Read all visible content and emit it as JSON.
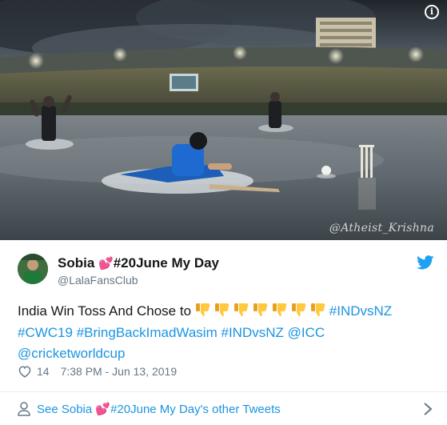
{
  "media": {
    "watermark": "@Atheist_Krishna",
    "info_icon": "i"
  },
  "author": {
    "name_prefix": "Sobia",
    "name_heart": "💕",
    "name_suffix": "#20June My Day",
    "handle": "@LalaFansClub"
  },
  "tweet": {
    "text_intro": "India Win Toss And Chose to ",
    "thumbs_down_count": 7,
    "hashtag_1": "#INDvsNZ",
    "hashtag_2": "#CWC19",
    "hashtag_3": "#BringBackImadWasim",
    "hashtag_4": "#INDvsNZ",
    "mention_1": "@ICC",
    "mention_2": "@cricketworldcup",
    "likes": "14",
    "timestamp": "7:38 PM - Jun 13, 2019"
  },
  "footer": {
    "label_prefix": "See Sobia ",
    "label_heart": "💕",
    "label_suffix": "#20June My Day's other Tweets"
  },
  "colors": {
    "link": "#1b95e0",
    "heart": "#e0245e",
    "muted": "#657786",
    "twitter_blue": "#1da1f2"
  }
}
